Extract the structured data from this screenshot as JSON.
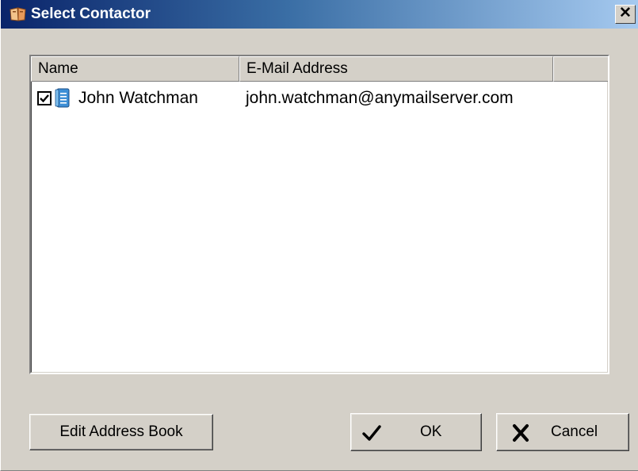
{
  "window": {
    "title": "Select Contactor",
    "close_glyph": "✕",
    "app_icon": "address-book-icon"
  },
  "list": {
    "columns": [
      "Name",
      "E-Mail Address",
      ""
    ],
    "rows": [
      {
        "checked": true,
        "icon": "contact-card-icon",
        "name": "John Watchman",
        "email": "john.watchman@anymailserver.com"
      }
    ]
  },
  "buttons": {
    "edit_label": "Edit Address Book",
    "ok_label": "OK",
    "ok_icon": "checkmark-icon",
    "cancel_label": "Cancel",
    "cancel_icon": "x-icon"
  },
  "colors": {
    "titlebar_start": "#0a246a",
    "titlebar_end": "#a6caf0",
    "face": "#d4d0c8"
  }
}
